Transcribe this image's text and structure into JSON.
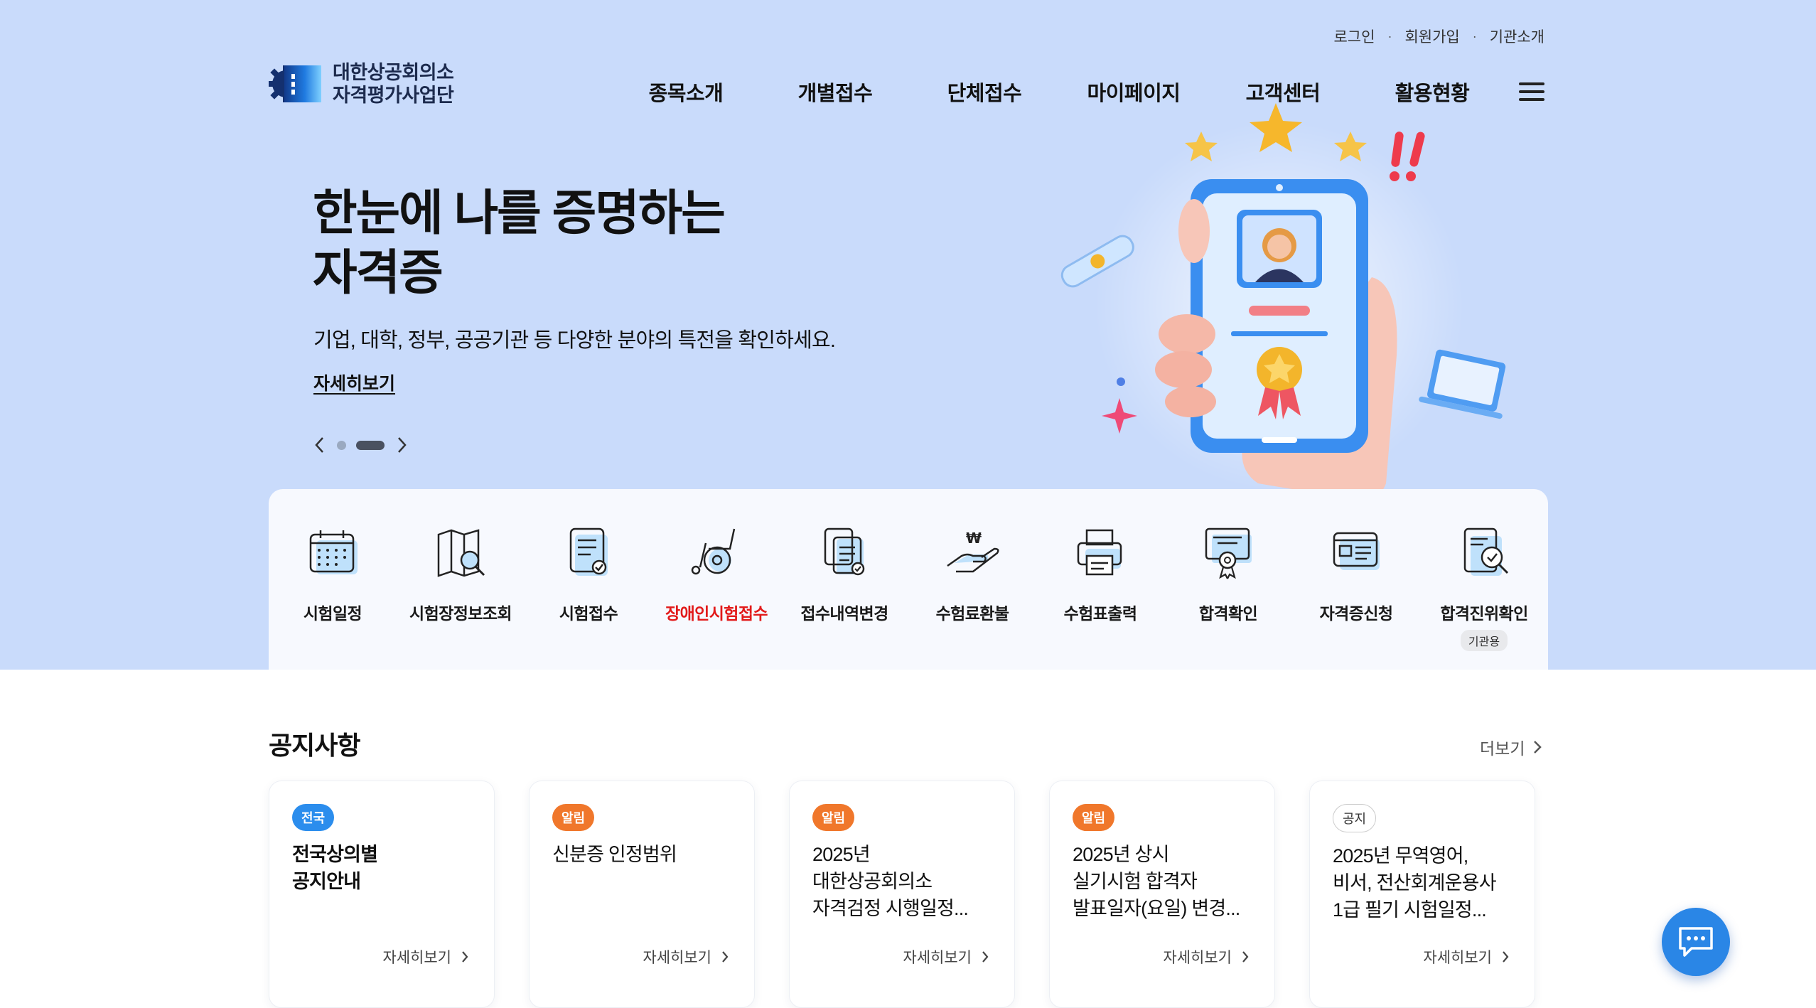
{
  "header": {
    "util_links": [
      "로그인",
      "회원가입",
      "기관소개"
    ],
    "logo_line1": "대한상공회의소",
    "logo_line2": "자격평가사업단",
    "nav": [
      "종목소개",
      "개별접수",
      "단체접수",
      "마이페이지",
      "고객센터",
      "활용현황"
    ]
  },
  "hero": {
    "headline_line1": "한눈에 나를 증명하는",
    "headline_line2": "자격증",
    "subtext": "기업, 대학, 정부, 공공기관 등 다양한 분야의 특전을 확인하세요.",
    "more_label": "자세히보기",
    "background_color": "#c9dbfb"
  },
  "quick_menu": [
    {
      "label": "시험일정",
      "icon": "calendar-icon"
    },
    {
      "label": "시험장정보조회",
      "icon": "map-search-icon"
    },
    {
      "label": "시험접수",
      "icon": "document-check-icon"
    },
    {
      "label": "장애인시험접수",
      "icon": "wheelchair-icon",
      "highlight": true
    },
    {
      "label": "접수내역변경",
      "icon": "documents-change-icon"
    },
    {
      "label": "수험료환불",
      "icon": "refund-hand-icon"
    },
    {
      "label": "수험표출력",
      "icon": "printer-icon"
    },
    {
      "label": "합격확인",
      "icon": "certificate-medal-icon"
    },
    {
      "label": "자격증신청",
      "icon": "id-card-icon"
    },
    {
      "label": "합격진위확인",
      "icon": "document-verify-icon",
      "badge": "기관용"
    }
  ],
  "notice": {
    "title": "공지사항",
    "more_label": "더보기",
    "cards": [
      {
        "badge": "전국",
        "badge_style": "blue",
        "lines": [
          "전국상의별",
          "공지안내"
        ],
        "bold": true,
        "more": "자세히보기"
      },
      {
        "badge": "알림",
        "badge_style": "orange",
        "lines": [
          "신분증 인정범위"
        ],
        "bold": false,
        "more": "자세히보기"
      },
      {
        "badge": "알림",
        "badge_style": "orange",
        "lines": [
          "2025년",
          "대한상공회의소",
          "자격검정 시행일정..."
        ],
        "bold": false,
        "more": "자세히보기"
      },
      {
        "badge": "알림",
        "badge_style": "orange",
        "lines": [
          "2025년 상시",
          "실기시험 합격자",
          "발표일자(요일) 변경..."
        ],
        "bold": false,
        "more": "자세히보기"
      },
      {
        "badge": "공지",
        "badge_style": "outline",
        "lines": [
          "2025년 무역영어,",
          "비서, 전산회계운용사",
          "1급 필기 시험일정..."
        ],
        "bold": false,
        "more": "자세히보기"
      }
    ]
  },
  "colors": {
    "accent_blue": "#2b8ded",
    "accent_orange": "#f0772b",
    "highlight_red": "#e21a1a",
    "chat_button": "#2a86e6"
  }
}
